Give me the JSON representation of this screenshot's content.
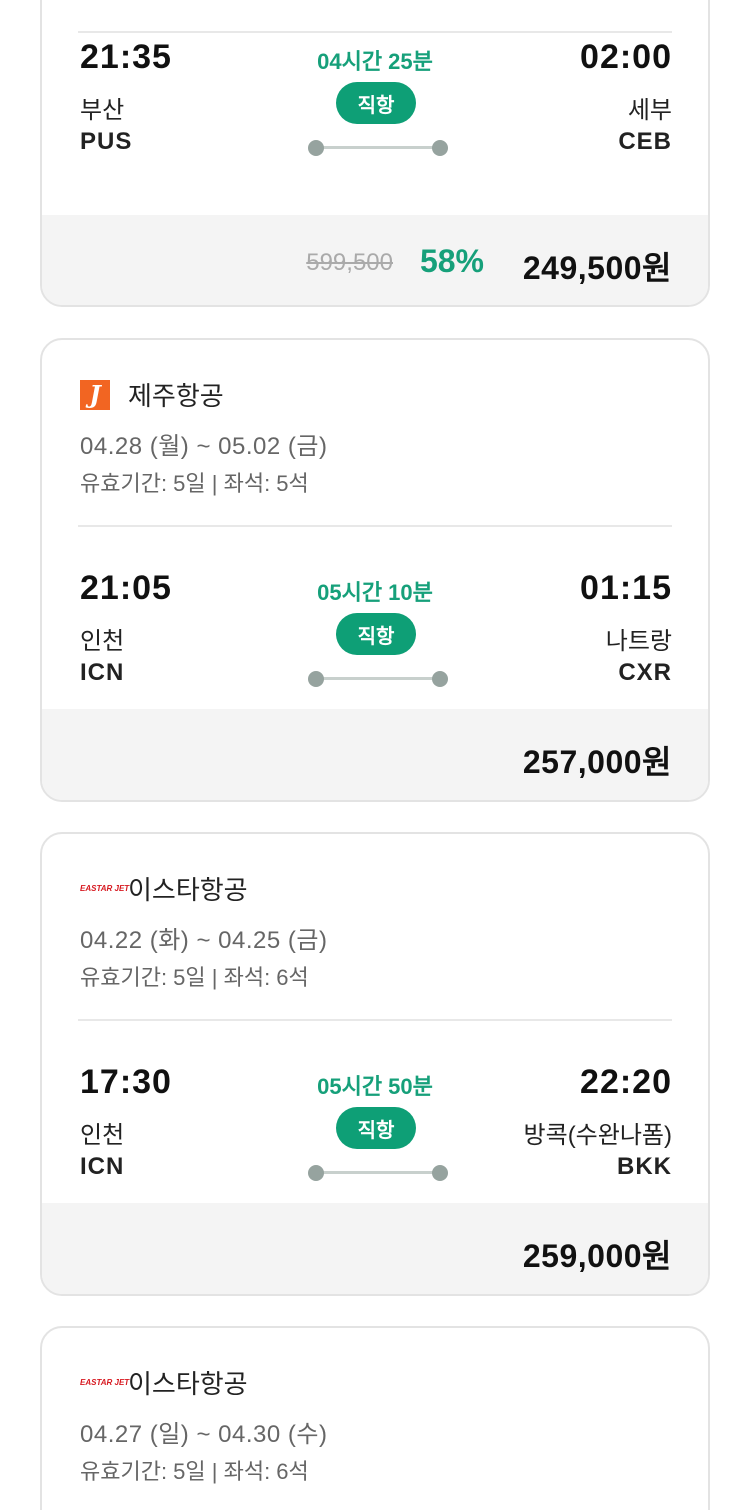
{
  "cards": [
    {
      "airline": "",
      "dates": "",
      "validity": "",
      "flight": {
        "dep_time": "21:35",
        "dep_city": "부산",
        "dep_code": "PUS",
        "duration": "04시간 25분",
        "badge": "직항",
        "arr_time": "02:00",
        "arr_city": "세부",
        "arr_code": "CEB"
      },
      "price": {
        "original": "599,500",
        "discount": "58%",
        "final": "249,500원"
      }
    },
    {
      "airline": "제주항공",
      "logo": "jeju-air-logo",
      "logo_text": "J",
      "dates": "04.28 (월) ~ 05.02 (금)",
      "validity": "유효기간: 5일 | 좌석: 5석",
      "flight": {
        "dep_time": "21:05",
        "dep_city": "인천",
        "dep_code": "ICN",
        "duration": "05시간 10분",
        "badge": "직항",
        "arr_time": "01:15",
        "arr_city": "나트랑",
        "arr_code": "CXR"
      },
      "price": {
        "final": "257,000원"
      }
    },
    {
      "airline": "이스타항공",
      "logo": "eastar-jet-logo",
      "logo_text": "EASTAR JET",
      "dates": "04.22 (화) ~ 04.25 (금)",
      "validity": "유효기간: 5일 | 좌석: 6석",
      "flight": {
        "dep_time": "17:30",
        "dep_city": "인천",
        "dep_code": "ICN",
        "duration": "05시간 50분",
        "badge": "직항",
        "arr_time": "22:20",
        "arr_city": "방콕(수완나폼)",
        "arr_code": "BKK"
      },
      "price": {
        "final": "259,000원"
      }
    },
    {
      "airline": "이스타항공",
      "logo": "eastar-jet-logo",
      "logo_text": "EASTAR JET",
      "dates": "04.27 (일) ~ 04.30 (수)",
      "validity": "유효기간: 5일 | 좌석: 6석"
    }
  ],
  "colors": {
    "accent": "#0e9f76",
    "accent_text": "#16a07a",
    "jeju": "#f26522",
    "eastar": "#d71920"
  }
}
